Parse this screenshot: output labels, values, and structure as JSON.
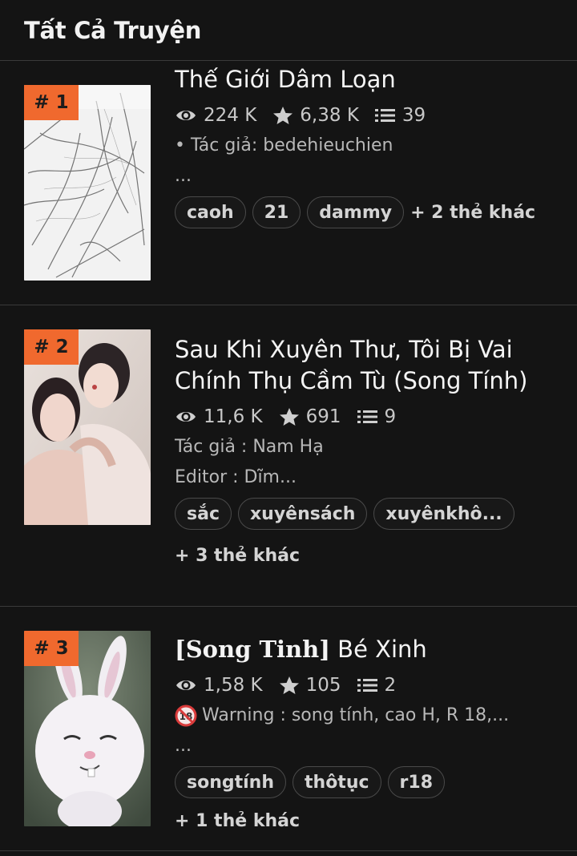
{
  "header": {
    "title": "Tất Cả Truyện"
  },
  "stories": [
    {
      "rank": "# 1",
      "title": "Thế Giới Dâm Loạn",
      "views": "224 K",
      "rating": "6,38 K",
      "chapters": "39",
      "desc_line1": "• Tác giả: bedehieuchien",
      "desc_line2": "...",
      "tags": [
        "caoh",
        "21",
        "dammy"
      ],
      "more_tags": "+ 2 thẻ khác"
    },
    {
      "rank": "# 2",
      "title_line1": "Sau Khi Xuyên Thư, Tôi Bị Vai",
      "title_line2": "Chính Thụ Cầm Tù (Song Tính)",
      "views": "11,6 K",
      "rating": "691",
      "chapters": "9",
      "desc_line1": "Tác giả : Nam Hạ",
      "desc_line2": "Editor : Dĩm...",
      "tags": [
        "sắc",
        "xuyênsách",
        "xuyênkhô..."
      ],
      "more_tags": "+ 3 thẻ khác"
    },
    {
      "rank": "# 3",
      "title_prefix": "[Song Tinh]",
      "title_suffix": " Bé Xinh",
      "views": "1,58 K",
      "rating": "105",
      "chapters": "2",
      "desc_line1": "Warning : song tính, cao H, R 18,...",
      "desc_line2": "...",
      "tags": [
        "songtính",
        "thôtục",
        "r18"
      ],
      "more_tags": "+ 1 thẻ khác"
    }
  ],
  "icons": {
    "views": "eye-icon",
    "rating": "star-icon",
    "chapters": "list-icon",
    "warning": "no-under-18-icon"
  },
  "colors": {
    "background": "#141414",
    "rank_badge": "#f0692e",
    "divider": "#3a3a3a"
  }
}
